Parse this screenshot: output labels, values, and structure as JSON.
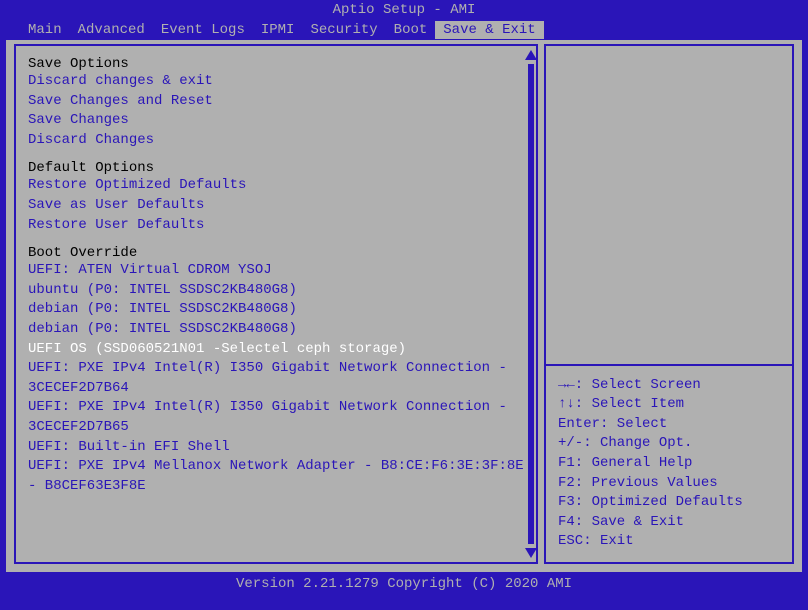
{
  "title": "Aptio Setup - AMI",
  "menu": [
    "Main",
    "Advanced",
    "Event Logs",
    "IPMI",
    "Security",
    "Boot",
    "Save & Exit"
  ],
  "active_menu_index": 6,
  "sections": {
    "save_options_header": "Save Options",
    "save_options": [
      "Discard changes & exit",
      "Save Changes and Reset",
      "Save Changes",
      "Discard Changes"
    ],
    "default_options_header": "Default Options",
    "default_options": [
      "Restore Optimized Defaults",
      "Save as User Defaults",
      "Restore User Defaults"
    ],
    "boot_override_header": "Boot Override",
    "boot_override": [
      "UEFI: ATEN Virtual CDROM YSOJ",
      "ubuntu (P0: INTEL SSDSC2KB480G8)",
      "debian (P0: INTEL SSDSC2KB480G8)",
      "debian (P0: INTEL SSDSC2KB480G8)",
      "UEFI OS (SSD060521N01      -Selectel ceph storage)",
      "UEFI: PXE IPv4 Intel(R) I350 Gigabit Network Connection - 3CECEF2D7B64",
      "UEFI: PXE IPv4 Intel(R) I350 Gigabit Network Connection - 3CECEF2D7B65",
      "UEFI: Built-in EFI Shell",
      "UEFI: PXE IPv4 Mellanox Network Adapter - B8:CE:F6:3E:3F:8E - B8CEF63E3F8E"
    ],
    "selected_boot_index": 4
  },
  "help": {
    "l1": "→←: Select Screen",
    "l2": "↑↓: Select Item",
    "l3": "Enter: Select",
    "l4": "+/-: Change Opt.",
    "l5": "F1: General Help",
    "l6": "F2: Previous Values",
    "l7": "F3: Optimized Defaults",
    "l8": "F4: Save & Exit",
    "l9": "ESC: Exit"
  },
  "footer": "Version 2.21.1279 Copyright (C) 2020 AMI"
}
